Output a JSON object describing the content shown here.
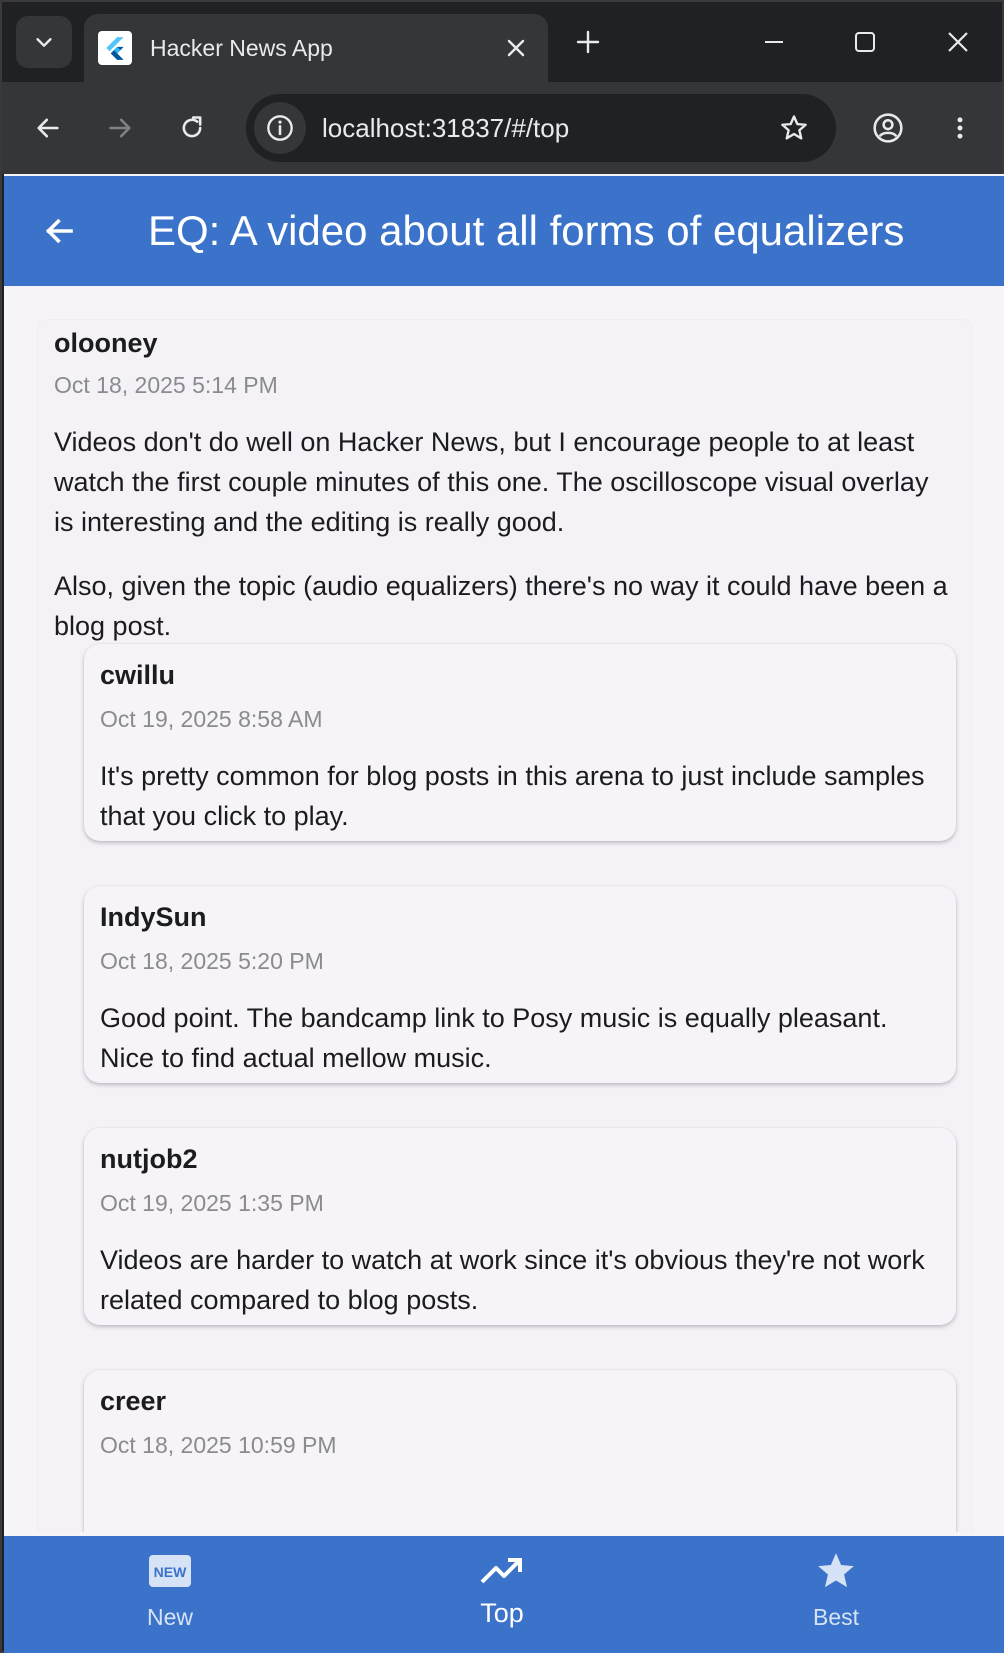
{
  "browser": {
    "tab_title": "Hacker News App",
    "url": "localhost:31837/#/top"
  },
  "app": {
    "title": "EQ: A video about all forms of equalizers",
    "colors": {
      "primary": "#3a73c9",
      "background": "#f7f4f9"
    }
  },
  "comment": {
    "author": "olooney",
    "date": "Oct 18, 2025 5:14 PM",
    "paragraphs": [
      "Videos don't do well on Hacker News, but I encourage people to at least watch the first couple minutes of this one. The oscilloscope visual overlay is interesting and the editing is really good.",
      "Also, given the topic (audio equalizers) there's no way it could have been a blog post."
    ]
  },
  "replies": [
    {
      "author": "cwillu",
      "date": "Oct 19, 2025 8:58 AM",
      "body": "It's pretty common for blog posts in this arena to just include samples that you click to play."
    },
    {
      "author": "IndySun",
      "date": "Oct 18, 2025 5:20 PM",
      "body": "Good point. The bandcamp link to Posy music is equally pleasant. Nice to find actual mellow music."
    },
    {
      "author": "nutjob2",
      "date": "Oct 19, 2025 1:35 PM",
      "body": "Videos are harder to watch at work since it's obvious they're not work related compared to blog posts."
    },
    {
      "author": "creer",
      "date": "Oct 18, 2025 10:59 PM",
      "body": ""
    }
  ],
  "bottom_nav": {
    "items": [
      {
        "label": "New",
        "icon": "new-badge-icon"
      },
      {
        "label": "Top",
        "icon": "trending-up-icon",
        "active": true
      },
      {
        "label": "Best",
        "icon": "star-icon"
      }
    ]
  }
}
